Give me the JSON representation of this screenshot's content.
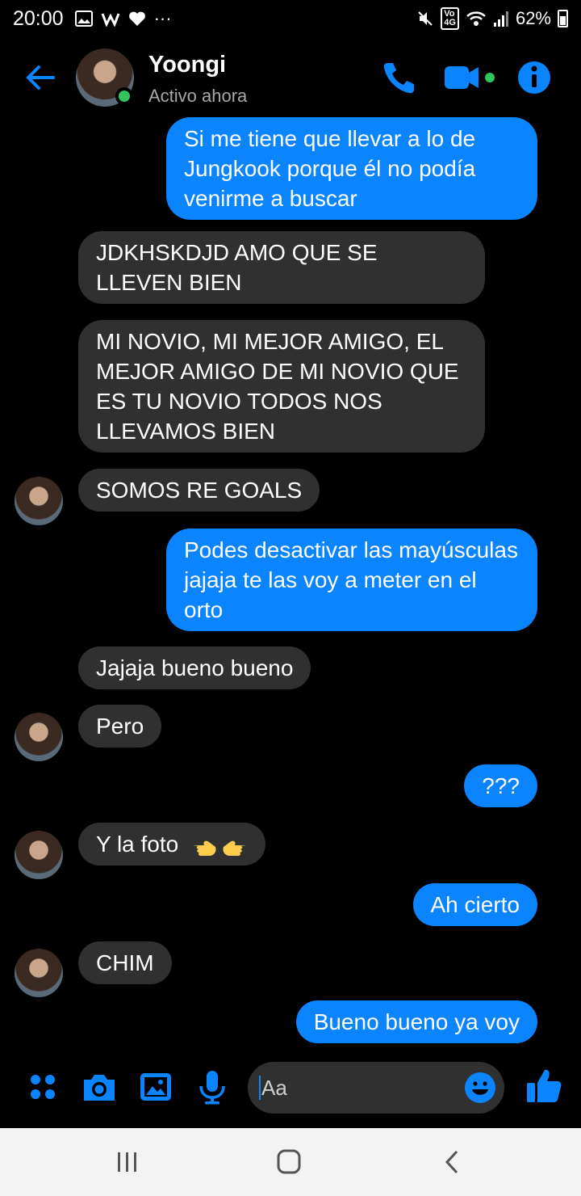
{
  "statusbar": {
    "time": "20:00",
    "left_icons": [
      "image-icon",
      "w-icon",
      "heart-icon",
      "more-icon"
    ],
    "network_badge": "VoLTE 4G",
    "battery": "62%"
  },
  "header": {
    "contact_name": "Yoongi",
    "contact_status": "Activo ahora",
    "colors": {
      "accent": "#0a84ff",
      "online": "#31c45a"
    }
  },
  "messages": [
    {
      "from": "me",
      "text": "Si me tiene que llevar a lo de Jungkook porque él no podía venirme a buscar"
    },
    {
      "from": "them",
      "text": "JDKHSKDJD AMO QUE SE LLEVEN BIEN"
    },
    {
      "from": "them",
      "text": "MI NOVIO, MI MEJOR AMIGO, EL MEJOR AMIGO DE MI NOVIO QUE ES TU NOVIO TODOS NOS LLEVAMOS BIEN"
    },
    {
      "from": "them",
      "text": "SOMOS RE GOALS"
    },
    {
      "from": "me",
      "text": "Podes desactivar las mayúsculas jajaja te las voy a meter en el orto"
    },
    {
      "from": "them",
      "text": "Jajaja bueno bueno"
    },
    {
      "from": "them",
      "text": "Pero"
    },
    {
      "from": "me",
      "text": "???"
    },
    {
      "from": "them",
      "text": "Y la foto",
      "emoji": "pointing-hands"
    },
    {
      "from": "me",
      "text": "Ah cierto"
    },
    {
      "from": "them",
      "text": "CHIM"
    },
    {
      "from": "me",
      "text": "Bueno bueno ya voy"
    }
  ],
  "composer": {
    "placeholder": "Aa",
    "buttons": [
      "menu-dots-icon",
      "camera-icon",
      "gallery-icon",
      "mic-icon",
      "emoji-icon",
      "like-icon"
    ]
  },
  "navbar": {
    "buttons": [
      "recents-icon",
      "home-icon",
      "back-icon"
    ]
  }
}
